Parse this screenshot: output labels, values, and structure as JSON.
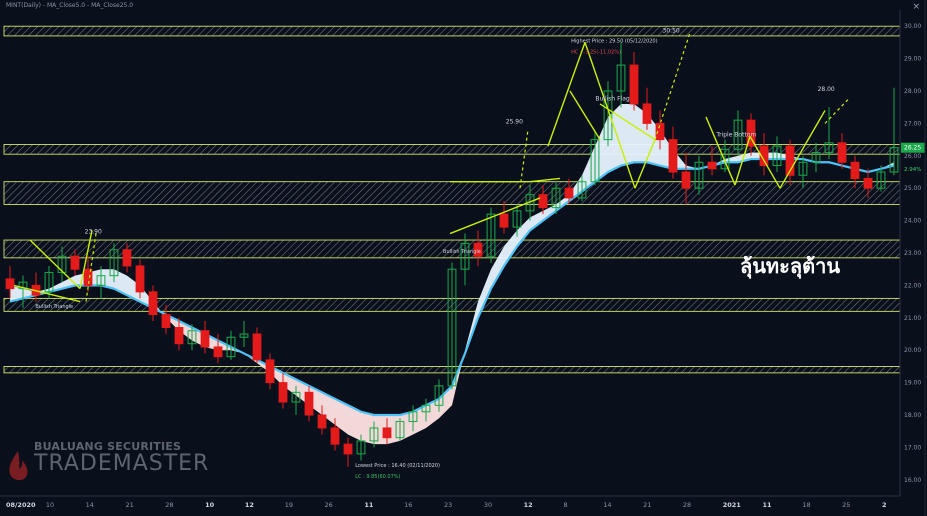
{
  "header": {
    "title": "MINT(Daily) - MA_Close5.0 - MA_Close25.0",
    "close_icon": "×"
  },
  "overlay_text": "ลุ้นทะลุต้าน",
  "logo": {
    "top": "BUALUANG SECURITIES",
    "bottom": "TRADEMASTER"
  },
  "colors": {
    "up": "#1aa84a",
    "down": "#e41b1b",
    "zone": "#e8ff70",
    "trend": "#c8f000",
    "cloud_up": "#e8f4ff",
    "cloud_down": "#ffe4e4",
    "ma": "#4fc3f7"
  },
  "chart_data": {
    "type": "candlestick",
    "title": "MINT(Daily) - MA_Close5.0 - MA_Close25.0",
    "ylim": [
      15.5,
      30.5
    ],
    "y_ticks": [
      "30.00",
      "29.00",
      "28.00",
      "27.00",
      "26.00",
      "25.00",
      "24.00",
      "23.00",
      "22.00",
      "21.00",
      "20.00",
      "19.00",
      "18.00",
      "17.00",
      "16.00"
    ],
    "x_labels": [
      "08/2020",
      "10",
      "14",
      "21",
      "28",
      "10",
      "12",
      "19",
      "26",
      "11",
      "16",
      "23",
      "30",
      "12",
      "8",
      "14",
      "21",
      "28",
      "2021",
      "11",
      "18",
      "25",
      "2"
    ],
    "last_price": "26.25",
    "last_change": "2.94%",
    "resistance_zones": [
      [
        29.7,
        30.0
      ],
      [
        26.05,
        26.35
      ],
      [
        24.5,
        25.2
      ],
      [
        22.85,
        23.4
      ],
      [
        21.2,
        21.6
      ],
      [
        19.3,
        19.5
      ]
    ],
    "annotations": [
      {
        "text": "Highest Price : 29.50 (05/12/2020)",
        "x": 0.633,
        "y": 29.5
      },
      {
        "text": "HC : -3.25(-11.02%)",
        "x": 0.633,
        "y": 29.15
      },
      {
        "text": "Lowest Price : 16.40 (02/11/2020)",
        "x": 0.392,
        "y": 16.4
      },
      {
        "text": "LC : 9.85(60.07%)",
        "x": 0.392,
        "y": 16.05
      },
      {
        "text": "Bullish Flag",
        "x": 0.66,
        "y": 27.7
      },
      {
        "text": "Triple Bottom",
        "x": 0.795,
        "y": 26.6
      },
      {
        "text": "Bullish Triangle",
        "x": 0.49,
        "y": 23.0
      },
      {
        "text": "Bullish Triangle",
        "x": 0.035,
        "y": 21.3
      },
      {
        "text": "23.90",
        "x": 0.09,
        "y": 23.6
      },
      {
        "text": "25.90",
        "x": 0.56,
        "y": 27.0
      },
      {
        "text": "30.50",
        "x": 0.735,
        "y": 29.8
      },
      {
        "text": "28.00",
        "x": 0.908,
        "y": 28.0
      }
    ],
    "ma5": [
      22.0,
      21.9,
      21.8,
      21.9,
      22.1,
      22.3,
      22.4,
      22.5,
      22.5,
      22.3,
      22.0,
      21.5,
      21.0,
      20.6,
      20.3,
      20.1,
      20.0,
      20.0,
      19.9,
      19.6,
      19.3,
      18.9,
      18.6,
      18.3,
      18.0,
      17.7,
      17.4,
      17.2,
      17.1,
      17.1,
      17.2,
      17.4,
      17.6,
      17.9,
      18.3,
      20.0,
      21.5,
      22.5,
      23.2,
      23.7,
      24.1,
      24.3,
      24.5,
      24.8,
      25.4,
      26.3,
      27.2,
      27.6,
      27.6,
      27.3,
      26.8,
      26.2,
      25.7,
      25.6,
      25.7,
      25.9,
      26.0,
      26.1,
      26.1,
      26.1,
      26.0,
      25.9,
      25.8,
      25.8,
      25.7,
      25.6,
      25.5,
      25.6,
      25.8
    ],
    "ma25": [
      21.5,
      21.6,
      21.7,
      21.8,
      21.9,
      22.0,
      22.0,
      22.0,
      21.9,
      21.7,
      21.5,
      21.3,
      21.1,
      20.9,
      20.7,
      20.5,
      20.3,
      20.1,
      19.9,
      19.7,
      19.5,
      19.3,
      19.1,
      18.9,
      18.7,
      18.5,
      18.3,
      18.1,
      18.0,
      18.0,
      18.0,
      18.1,
      18.3,
      18.5,
      18.9,
      19.9,
      21.0,
      21.9,
      22.6,
      23.2,
      23.7,
      24.0,
      24.3,
      24.6,
      24.9,
      25.2,
      25.5,
      25.7,
      25.8,
      25.8,
      25.7,
      25.6,
      25.6,
      25.6,
      25.7,
      25.8,
      25.8,
      25.9,
      25.9,
      25.9,
      25.9,
      25.9,
      25.8,
      25.8,
      25.7,
      25.6,
      25.5,
      25.6,
      25.7
    ],
    "candles": [
      {
        "o": 22.2,
        "h": 22.6,
        "l": 21.6,
        "c": 21.9
      },
      {
        "o": 21.9,
        "h": 22.3,
        "l": 21.3,
        "c": 22.1
      },
      {
        "o": 22.0,
        "h": 22.4,
        "l": 21.5,
        "c": 21.7
      },
      {
        "o": 21.8,
        "h": 22.6,
        "l": 21.6,
        "c": 22.4
      },
      {
        "o": 22.4,
        "h": 23.2,
        "l": 22.1,
        "c": 22.9
      },
      {
        "o": 22.9,
        "h": 23.1,
        "l": 22.3,
        "c": 22.5
      },
      {
        "o": 22.5,
        "h": 22.9,
        "l": 21.8,
        "c": 22.0
      },
      {
        "o": 22.0,
        "h": 22.6,
        "l": 21.6,
        "c": 22.3
      },
      {
        "o": 22.3,
        "h": 23.3,
        "l": 22.1,
        "c": 23.1
      },
      {
        "o": 23.1,
        "h": 23.3,
        "l": 22.4,
        "c": 22.6
      },
      {
        "o": 22.6,
        "h": 22.8,
        "l": 21.6,
        "c": 21.8
      },
      {
        "o": 21.8,
        "h": 22.0,
        "l": 20.9,
        "c": 21.1
      },
      {
        "o": 21.1,
        "h": 21.4,
        "l": 20.5,
        "c": 20.7
      },
      {
        "o": 20.7,
        "h": 21.0,
        "l": 20.0,
        "c": 20.2
      },
      {
        "o": 20.2,
        "h": 20.8,
        "l": 20.0,
        "c": 20.6
      },
      {
        "o": 20.6,
        "h": 20.9,
        "l": 19.9,
        "c": 20.1
      },
      {
        "o": 20.1,
        "h": 20.5,
        "l": 19.6,
        "c": 19.8
      },
      {
        "o": 19.8,
        "h": 20.6,
        "l": 19.7,
        "c": 20.4
      },
      {
        "o": 20.4,
        "h": 20.9,
        "l": 20.1,
        "c": 20.5
      },
      {
        "o": 20.5,
        "h": 20.7,
        "l": 19.6,
        "c": 19.7
      },
      {
        "o": 19.7,
        "h": 19.9,
        "l": 18.8,
        "c": 19.0
      },
      {
        "o": 19.0,
        "h": 19.3,
        "l": 18.2,
        "c": 18.4
      },
      {
        "o": 18.4,
        "h": 18.9,
        "l": 18.0,
        "c": 18.7
      },
      {
        "o": 18.7,
        "h": 18.9,
        "l": 17.8,
        "c": 18.0
      },
      {
        "o": 18.0,
        "h": 18.3,
        "l": 17.4,
        "c": 17.6
      },
      {
        "o": 17.6,
        "h": 17.9,
        "l": 16.9,
        "c": 17.1
      },
      {
        "o": 17.1,
        "h": 17.3,
        "l": 16.4,
        "c": 16.8
      },
      {
        "o": 16.8,
        "h": 17.4,
        "l": 16.6,
        "c": 17.2
      },
      {
        "o": 17.2,
        "h": 17.8,
        "l": 17.0,
        "c": 17.6
      },
      {
        "o": 17.6,
        "h": 17.9,
        "l": 17.1,
        "c": 17.3
      },
      {
        "o": 17.3,
        "h": 17.9,
        "l": 17.2,
        "c": 17.8
      },
      {
        "o": 17.8,
        "h": 18.3,
        "l": 17.5,
        "c": 18.1
      },
      {
        "o": 18.1,
        "h": 18.5,
        "l": 17.8,
        "c": 18.3
      },
      {
        "o": 18.3,
        "h": 19.1,
        "l": 18.1,
        "c": 18.9
      },
      {
        "o": 18.9,
        "h": 22.7,
        "l": 18.8,
        "c": 22.5
      },
      {
        "o": 22.5,
        "h": 23.6,
        "l": 22.0,
        "c": 23.3
      },
      {
        "o": 23.3,
        "h": 23.7,
        "l": 22.6,
        "c": 22.9
      },
      {
        "o": 22.9,
        "h": 24.4,
        "l": 22.7,
        "c": 24.2
      },
      {
        "o": 24.2,
        "h": 24.6,
        "l": 23.6,
        "c": 23.8
      },
      {
        "o": 23.8,
        "h": 24.5,
        "l": 23.5,
        "c": 24.3
      },
      {
        "o": 24.3,
        "h": 25.1,
        "l": 24.0,
        "c": 24.8
      },
      {
        "o": 24.8,
        "h": 25.1,
        "l": 24.2,
        "c": 24.4
      },
      {
        "o": 24.4,
        "h": 25.2,
        "l": 24.2,
        "c": 25.0
      },
      {
        "o": 25.0,
        "h": 25.3,
        "l": 24.5,
        "c": 24.7
      },
      {
        "o": 24.7,
        "h": 25.4,
        "l": 24.6,
        "c": 25.2
      },
      {
        "o": 25.2,
        "h": 26.8,
        "l": 25.1,
        "c": 26.5
      },
      {
        "o": 26.5,
        "h": 28.3,
        "l": 26.3,
        "c": 28.0
      },
      {
        "o": 28.0,
        "h": 29.5,
        "l": 27.5,
        "c": 28.8
      },
      {
        "o": 28.8,
        "h": 29.2,
        "l": 27.4,
        "c": 27.6
      },
      {
        "o": 27.6,
        "h": 28.1,
        "l": 26.8,
        "c": 27.0
      },
      {
        "o": 27.0,
        "h": 27.4,
        "l": 26.2,
        "c": 26.5
      },
      {
        "o": 26.5,
        "h": 26.9,
        "l": 25.3,
        "c": 25.5
      },
      {
        "o": 25.5,
        "h": 26.1,
        "l": 24.5,
        "c": 25.0
      },
      {
        "o": 25.0,
        "h": 26.0,
        "l": 24.8,
        "c": 25.8
      },
      {
        "o": 25.8,
        "h": 26.3,
        "l": 25.4,
        "c": 25.6
      },
      {
        "o": 25.6,
        "h": 26.5,
        "l": 25.5,
        "c": 26.2
      },
      {
        "o": 26.2,
        "h": 27.4,
        "l": 26.0,
        "c": 27.1
      },
      {
        "o": 27.1,
        "h": 27.3,
        "l": 26.0,
        "c": 26.3
      },
      {
        "o": 26.3,
        "h": 26.7,
        "l": 25.4,
        "c": 25.7
      },
      {
        "o": 25.7,
        "h": 26.6,
        "l": 25.5,
        "c": 26.3
      },
      {
        "o": 26.3,
        "h": 26.5,
        "l": 25.1,
        "c": 25.4
      },
      {
        "o": 25.4,
        "h": 26.0,
        "l": 25.0,
        "c": 25.8
      },
      {
        "o": 25.8,
        "h": 26.4,
        "l": 25.5,
        "c": 26.1
      },
      {
        "o": 26.1,
        "h": 27.5,
        "l": 25.9,
        "c": 26.4
      },
      {
        "o": 26.4,
        "h": 26.7,
        "l": 25.6,
        "c": 25.8
      },
      {
        "o": 25.8,
        "h": 26.0,
        "l": 25.0,
        "c": 25.3
      },
      {
        "o": 25.3,
        "h": 25.6,
        "l": 24.7,
        "c": 25.0
      },
      {
        "o": 25.0,
        "h": 25.7,
        "l": 24.9,
        "c": 25.5
      },
      {
        "o": 25.5,
        "h": 28.1,
        "l": 25.4,
        "c": 26.25
      }
    ]
  }
}
